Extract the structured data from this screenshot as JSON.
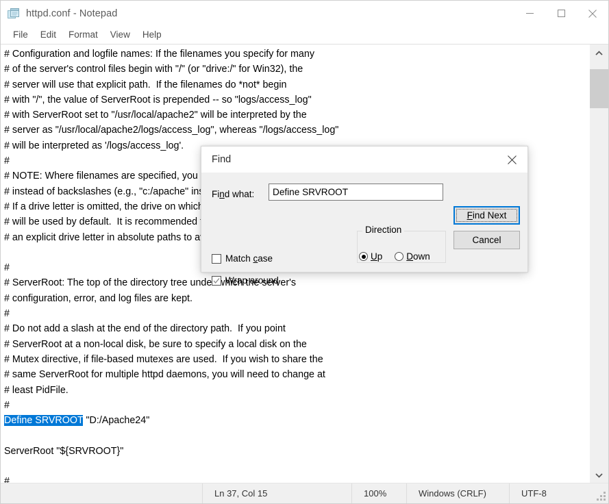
{
  "window": {
    "icon": "notepad-icon",
    "title": "httpd.conf - Notepad",
    "controls": {
      "minimize": "minimize-icon",
      "maximize": "maximize-icon",
      "close": "close-icon"
    }
  },
  "menu": {
    "items": [
      {
        "label": "File"
      },
      {
        "label": "Edit"
      },
      {
        "label": "Format"
      },
      {
        "label": "View"
      },
      {
        "label": "Help"
      }
    ]
  },
  "editor": {
    "lines": [
      "# Configuration and logfile names: If the filenames you specify for many",
      "# of the server's control files begin with \"/\" (or \"drive:/\" for Win32), the",
      "# server will use that explicit path.  If the filenames do *not* begin",
      "# with \"/\", the value of ServerRoot is prepended -- so \"logs/access_log\"",
      "# with ServerRoot set to \"/usr/local/apache2\" will be interpreted by the",
      "# server as \"/usr/local/apache2/logs/access_log\", whereas \"/logs/access_log\"",
      "# will be interpreted as '/logs/access_log'.",
      "#",
      "# NOTE: Where filenames are specified, you must use forward slashes",
      "# instead of backslashes (e.g., \"c:/apache\" instead of \"c:\\apache\").",
      "# If a drive letter is omitted, the drive on which httpd.exe is located",
      "# will be used by default.  It is recommended that you always supply",
      "# an explicit drive letter in absolute paths to avoid confusion.",
      "",
      "#",
      "# ServerRoot: The top of the directory tree under which the server's",
      "# configuration, error, and log files are kept.",
      "#",
      "# Do not add a slash at the end of the directory path.  If you point",
      "# ServerRoot at a non-local disk, be sure to specify a local disk on the",
      "# Mutex directive, if file-based mutexes are used.  If you wish to share the",
      "# same ServerRoot for multiple httpd daemons, you will need to change at",
      "# least PidFile.",
      "#"
    ],
    "selected_line": {
      "selected_text": "Define SRVROOT",
      "rest": " \"D:/Apache24\""
    },
    "lines_after": [
      "",
      "ServerRoot \"${SRVROOT}\"",
      "",
      "#"
    ],
    "selection_color": "#0078d7"
  },
  "scrollbar": {
    "up_arrow": "chevron-up-icon",
    "down_arrow": "chevron-down-icon"
  },
  "statusbar": {
    "position": "Ln 37, Col 15",
    "zoom": "100%",
    "line_ending": "Windows (CRLF)",
    "encoding": "UTF-8",
    "grip": "resize-grip-icon"
  },
  "find_dialog": {
    "title": "Find",
    "close_icon": "close-icon",
    "find_what_label": "Find what:",
    "find_what_label_parts": {
      "pre": "Fi",
      "accel": "n",
      "post": "d what:"
    },
    "find_what_value": "Define SRVROOT",
    "find_what_placeholder": "",
    "buttons": {
      "find_next": "Find Next",
      "find_next_parts": {
        "accel": "F",
        "post": "ind Next"
      },
      "cancel": "Cancel"
    },
    "direction": {
      "legend": "Direction",
      "options": [
        {
          "label": "Up",
          "accel": "U",
          "post": "p",
          "selected": true
        },
        {
          "label": "Down",
          "accel": "D",
          "post": "own",
          "selected": false
        }
      ]
    },
    "checkboxes": [
      {
        "name": "match-case",
        "pre": "Match ",
        "accel": "c",
        "post": "ase",
        "checked": false
      },
      {
        "name": "wrap-around",
        "pre": "W",
        "accel": "r",
        "post": "ap around",
        "checked": true
      }
    ],
    "focus_color": "#0078d7"
  }
}
